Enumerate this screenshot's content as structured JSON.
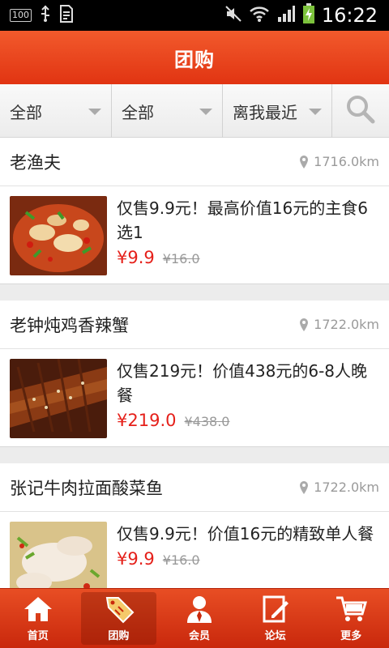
{
  "status_bar": {
    "battery_box": "100",
    "time": "16:22"
  },
  "header": {
    "title": "团购"
  },
  "filters": [
    {
      "label": "全部"
    },
    {
      "label": "全部"
    },
    {
      "label": "离我最近"
    }
  ],
  "deals": [
    {
      "shop": "老渔夫",
      "distance": "1716.0km",
      "description": "仅售9.9元！最高价值16元的主食6选1",
      "price": "¥9.9",
      "original_price": "¥16.0"
    },
    {
      "shop": "老钟炖鸡香辣蟹",
      "distance": "1722.0km",
      "description": "仅售219元！价值438元的6-8人晚餐",
      "price": "¥219.0",
      "original_price": "¥438.0"
    },
    {
      "shop": "张记牛肉拉面酸菜鱼",
      "distance": "1722.0km",
      "description": "仅售9.9元！价值16元的精致单人餐",
      "price": "¥9.9",
      "original_price": "¥16.0"
    }
  ],
  "nav": [
    {
      "label": "首页",
      "icon": "home-icon"
    },
    {
      "label": "团购",
      "icon": "sale-tag-icon",
      "active": true
    },
    {
      "label": "会员",
      "icon": "member-icon"
    },
    {
      "label": "论坛",
      "icon": "forum-icon"
    },
    {
      "label": "更多",
      "icon": "cart-icon"
    }
  ],
  "colors": {
    "accent": "#e13412",
    "price": "#e5201a"
  }
}
